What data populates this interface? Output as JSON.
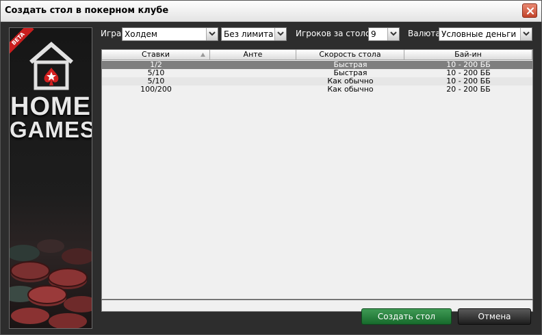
{
  "window": {
    "title": "Создать стол в покерном клубе"
  },
  "side_panel": {
    "badge": "BETA",
    "logo_line1": "HOME",
    "logo_line2": "GAMES"
  },
  "filters": {
    "game": {
      "label": "Игра:",
      "value": "Холдем"
    },
    "limit": {
      "value": "Без лимита"
    },
    "players": {
      "label": "Игроков за столом:",
      "value": "9"
    },
    "currency": {
      "label": "Валюта:",
      "value": "Условные деньги"
    }
  },
  "table": {
    "columns": [
      "Ставки",
      "Анте",
      "Скорость стола",
      "Бай-ин"
    ],
    "rows": [
      {
        "stakes": "1/2",
        "ante": "",
        "speed": "Быстрая",
        "buyin": "10 - 200 ББ",
        "selected": true
      },
      {
        "stakes": "5/10",
        "ante": "",
        "speed": "Быстрая",
        "buyin": "10 - 200 ББ",
        "selected": false
      },
      {
        "stakes": "5/10",
        "ante": "",
        "speed": "Как обычно",
        "buyin": "10 - 200 ББ",
        "selected": false
      },
      {
        "stakes": "100/200",
        "ante": "",
        "speed": "Как обычно",
        "buyin": "20 - 200 ББ",
        "selected": false
      }
    ]
  },
  "buttons": {
    "create": "Создать стол",
    "cancel": "Отмена"
  },
  "icons": {
    "close": "close-icon",
    "dropdown": "chevron-down-icon",
    "sort": "sort-ascending-icon",
    "logo": "spade-house-icon"
  },
  "colors": {
    "accent_green": "#1f7a35",
    "selected_row": "#7e7e7e",
    "close_red": "#c2432a"
  }
}
